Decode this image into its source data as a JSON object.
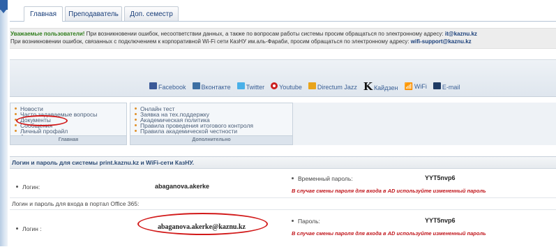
{
  "tabs": [
    {
      "label": "Главная",
      "active": true
    },
    {
      "label": "Преподаватель",
      "active": false
    },
    {
      "label": "Доп. семестр",
      "active": false
    }
  ],
  "notice": {
    "line1_bold": "Уважаемые пользователи!",
    "line1_text": " При возникновении ошибок, несоответствии данных, а также по вопросам работы системы просим обращаться по электронному адресу: ",
    "line1_email": "it@kaznu.kz",
    "line2_text": "При возникновении ошибок, связанных с подключением к корпоративной Wi-Fi сети КазНУ им.аль-Фараби, просим обращаться по электронному адресу: ",
    "line2_email": "wifi-support@kaznu.kz"
  },
  "social": [
    {
      "icon": "facebook-icon",
      "label": "Facebook"
    },
    {
      "icon": "vkontakte-icon",
      "label": "Вконтакте"
    },
    {
      "icon": "twitter-icon",
      "label": "Twitter"
    },
    {
      "icon": "youtube-icon",
      "label": "Youtube"
    },
    {
      "icon": "directum-icon",
      "label": "Directum Jazz"
    },
    {
      "icon": "kaidzen-icon",
      "label": "Кайдзен"
    },
    {
      "icon": "wifi-icon",
      "label": "WiFi"
    },
    {
      "icon": "email-icon",
      "label": "E-mail"
    }
  ],
  "menus": {
    "main": {
      "items": [
        "Новости",
        "Часто задаваемые вопросы",
        "Документы",
        "Сообщения",
        "Личный профайл",
        "Анкетирование глазами коллег"
      ],
      "footer": "Главная"
    },
    "extra": {
      "items": [
        "Онлайн тест",
        "Заявка на тех.поддержку",
        "Академическая политика",
        "Правила проведения итогового контроля",
        "Правила академической честности"
      ],
      "footer": "Дополнительно"
    }
  },
  "login_section": {
    "title": "Логин и пароль для системы print.kaznu.kz и WiFi-сети КазНУ.",
    "login_label": "Логин:",
    "login_value": "abaganova.akerke",
    "temp_password_label": "Временный пароль:",
    "temp_password_value": "YYT5nvp6",
    "warning": "В случае смены пароля для входа в AD используйте измененный пароль",
    "office_title": "Логин и пароль для входа в портал Office 365:",
    "office_login_label": "Логин :",
    "office_login_value": "abaganova.akerke@kaznu.kz",
    "office_password_label": "Пароль:",
    "office_password_value": "YYT5nvp6",
    "office_warning": "В случае смены пароля для входа в AD используйте измененный пароль"
  },
  "colors": {
    "brand_blue": "#2f62a8",
    "highlight_red": "#d21a1a",
    "notice_green": "#2f7d1b"
  }
}
